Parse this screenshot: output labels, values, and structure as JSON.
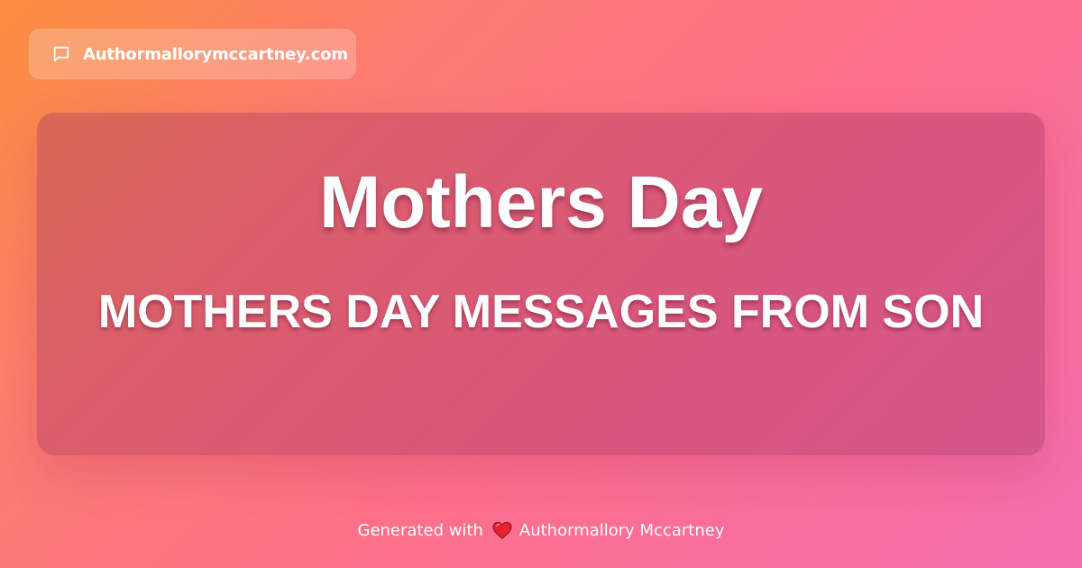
{
  "site_badge": {
    "icon": "chat-bubble-icon",
    "label": "Authormallorymccartney.com"
  },
  "card": {
    "title": "Mothers Day",
    "subtitle": "MOTHERS DAY MESSAGES FROM SON"
  },
  "footer": {
    "prefix": "Generated with",
    "icon": "heart-icon",
    "author": "Authormallory Mccartney"
  },
  "colors": {
    "gradient_start": "#fb8f3e",
    "gradient_mid": "#fd6f8b",
    "gradient_end": "#f46eae",
    "text": "#ffffff",
    "heart": "#e8232e"
  }
}
